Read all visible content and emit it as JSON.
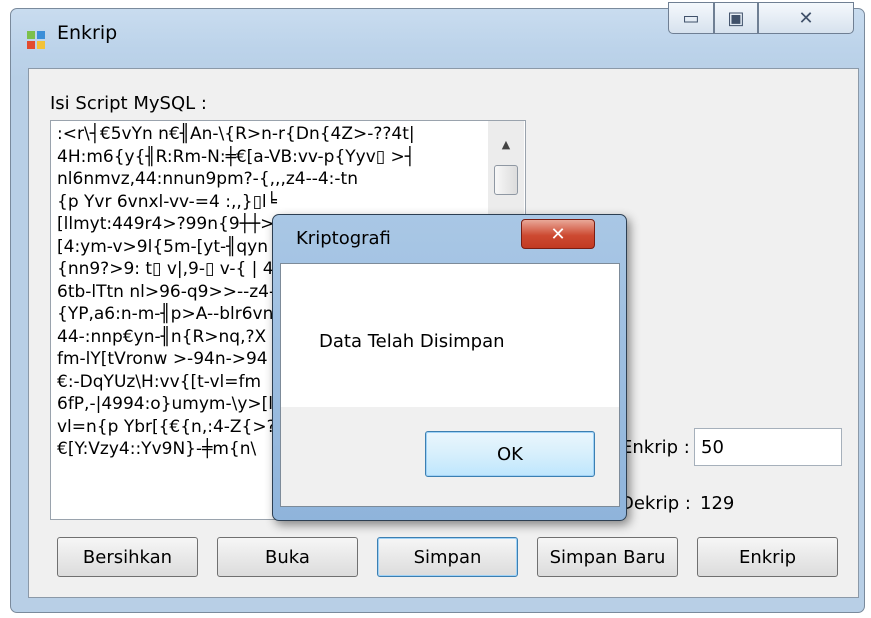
{
  "window": {
    "title": "Enkrip",
    "minimize_glyph": "▭",
    "maximize_glyph": "▣",
    "close_glyph": "✕"
  },
  "form": {
    "script_label": "Isi Script MySQL :",
    "script_text": ":<r\\┤€5vYn n€╢An-\\{R>n-r{Dn{4Z>-??4t|\n4H:m6{y{╢R:Rm-N:╪€[a-VB:vv-p{Yyv▯ >┤\nnl6nmvz,44:nnun9pm?-{,,,z4--4:-tn\n{p Yvr 6vnxl-vv-=4 :,,}▯l╘\n[llmyt:449r4>?99n{9┼┼>\n[4:ym-v>9l{5m-[yt-╢qyn 9\n{nn9?>9: t▯ v|,9-▯ v-{ | 4-\n6tb-lTtn nl>96-q9>>--z4-\n{YP,a6:n-m-╢p>A--blr6vn\n44-:nnp€yn-╢n{R>nq,?X\nfm-lY[tVronw >-94n->94\n€:-DqYUz\\H:vv{[t-vl=fm\n6fP,-|4994:o}umym-\\y>[l\nvl=n{p Ybr[{€{n,:4-Z{>?-\n€[Y:Vzy4::Yv9N}-╪m{n\\",
    "enkrip_label": "Enkrip :",
    "enkrip_value": "50",
    "dekrip_label": "Dekrip :",
    "dekrip_value": "129",
    "scroll_up_glyph": "▲"
  },
  "buttons": {
    "bersihkan": "Bersihkan",
    "buka": "Buka",
    "simpan": "Simpan",
    "simpan_baru": "Simpan Baru",
    "enkrip": "Enkrip"
  },
  "dialog": {
    "title": "Kriptografi",
    "close_glyph": "✕",
    "message": "Data Telah Disimpan",
    "ok_label": "OK"
  }
}
